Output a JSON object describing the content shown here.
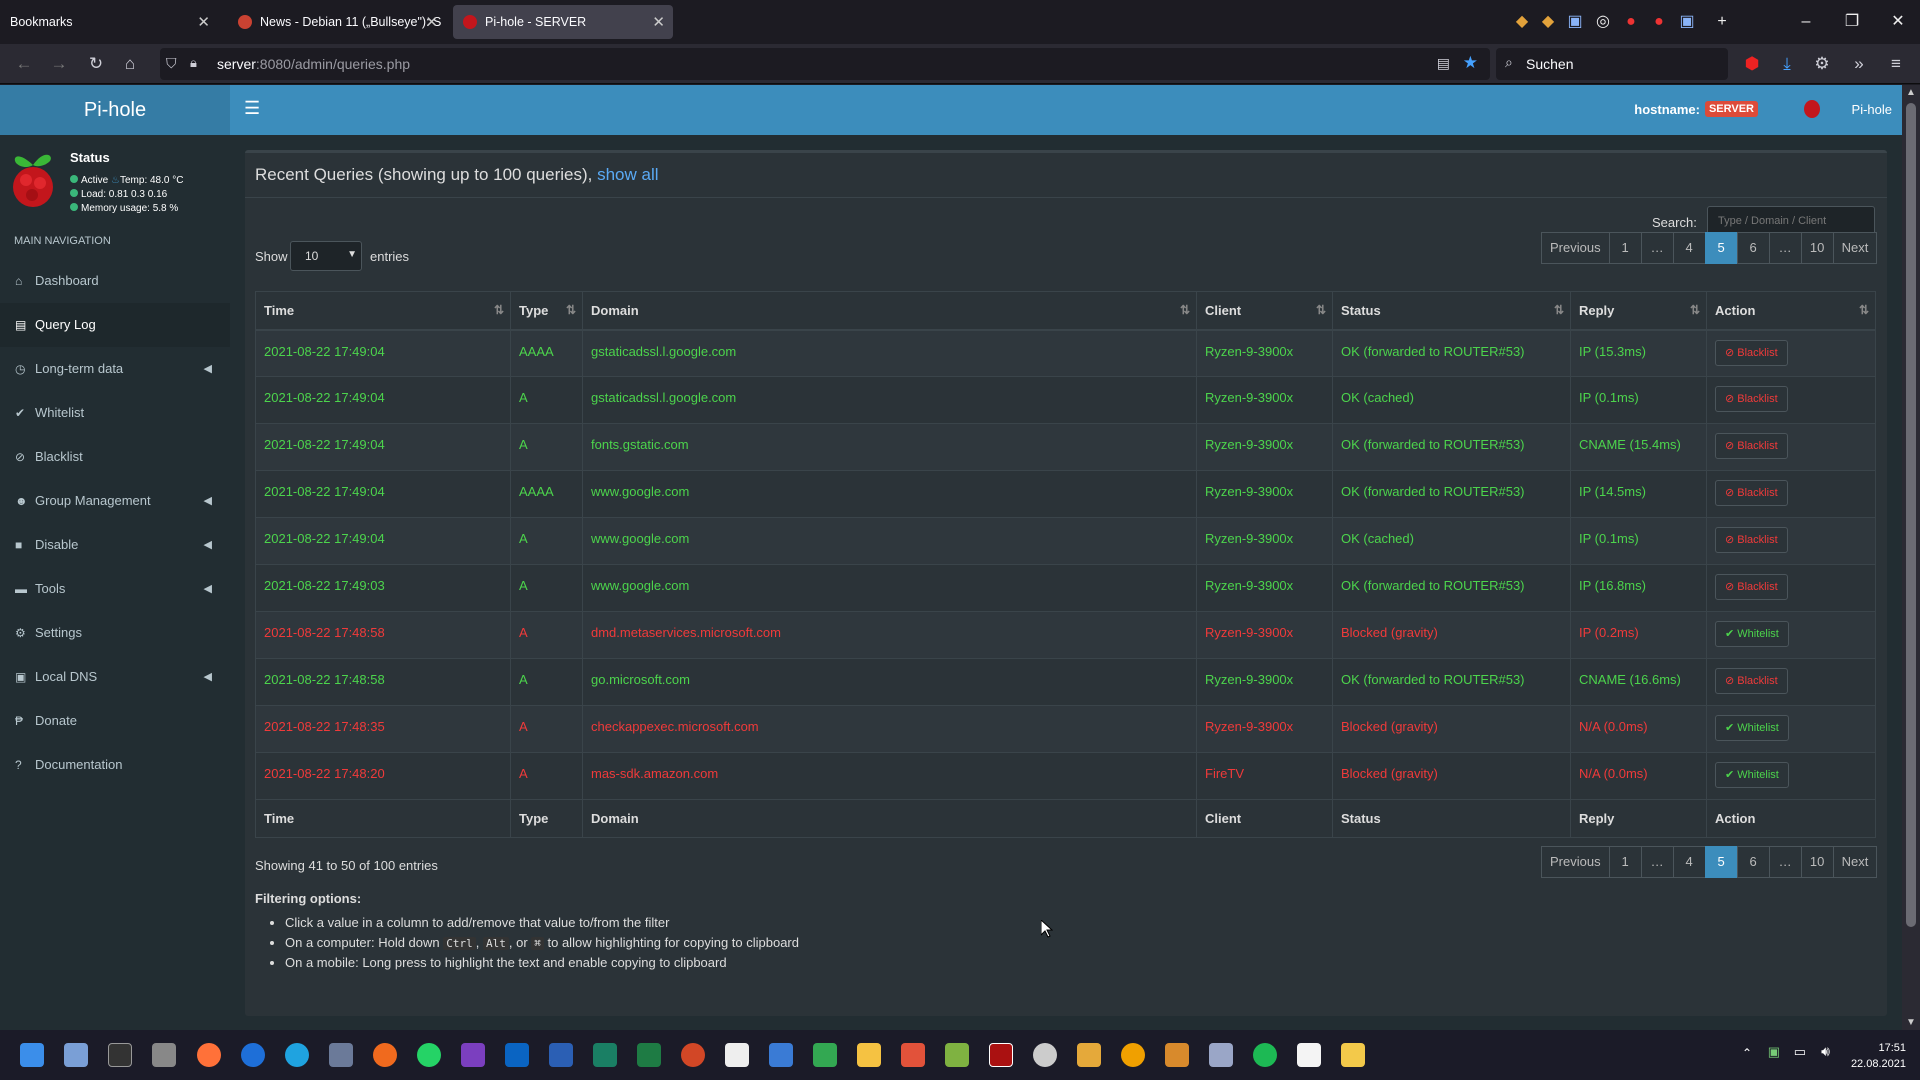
{
  "browser": {
    "tabs": [
      {
        "label": "Bookmarks"
      },
      {
        "label": "News - Debian 11 („Bullseye\"): S"
      },
      {
        "label": "Pi-hole - SERVER"
      }
    ],
    "url_host": "server",
    "url_path": ":8080/admin/queries.php",
    "search_placeholder": "Suchen"
  },
  "header": {
    "logo": "Pi-hole",
    "hostname_label": "hostname:",
    "hostname_value": "SERVER",
    "user_label": "Pi-hole"
  },
  "sidebar": {
    "status_title": "Status",
    "status_active": "Active",
    "status_temp": "Temp: 48.0 °C",
    "status_load": "Load:  0.81  0.3  0.16",
    "status_memory": "Memory usage:  5.8 %",
    "nav_header": "MAIN NAVIGATION",
    "items": [
      {
        "label": "Dashboard",
        "icon": "home-icon"
      },
      {
        "label": "Query Log",
        "icon": "file-icon"
      },
      {
        "label": "Long-term data",
        "icon": "clock-icon"
      },
      {
        "label": "Whitelist",
        "icon": "check-circle-icon"
      },
      {
        "label": "Blacklist",
        "icon": "ban-icon"
      },
      {
        "label": "Group Management",
        "icon": "users-icon"
      },
      {
        "label": "Disable",
        "icon": "stop-icon"
      },
      {
        "label": "Tools",
        "icon": "folder-icon"
      },
      {
        "label": "Settings",
        "icon": "cogs-icon"
      },
      {
        "label": "Local DNS",
        "icon": "address-book-icon"
      },
      {
        "label": "Donate",
        "icon": "paypal-icon"
      },
      {
        "label": "Documentation",
        "icon": "question-circle-icon"
      }
    ]
  },
  "main": {
    "title_prefix": "Recent Queries (showing up to 100 queries), ",
    "title_link": "show all",
    "show_label": "Show",
    "entries_value": "10",
    "entries_label": "entries",
    "search_label": "Search:",
    "search_placeholder": "Type / Domain / Client",
    "pagination": [
      "Previous",
      "1",
      "…",
      "4",
      "5",
      "6",
      "…",
      "10",
      "Next"
    ],
    "active_page": "5",
    "columns": [
      "Time",
      "Type",
      "Domain",
      "Client",
      "Status",
      "Reply",
      "Action"
    ],
    "rows": [
      {
        "time": "2021-08-22 17:49:04",
        "type": "AAAA",
        "domain": "gstaticadssl.l.google.com",
        "client": "Ryzen-9-3900x",
        "status": "OK (forwarded to ROUTER#53)",
        "reply": "IP (15.3ms)",
        "action": "Blacklist",
        "blocked": false
      },
      {
        "time": "2021-08-22 17:49:04",
        "type": "A",
        "domain": "gstaticadssl.l.google.com",
        "client": "Ryzen-9-3900x",
        "status": "OK (cached)",
        "reply": "IP (0.1ms)",
        "action": "Blacklist",
        "blocked": false
      },
      {
        "time": "2021-08-22 17:49:04",
        "type": "A",
        "domain": "fonts.gstatic.com",
        "client": "Ryzen-9-3900x",
        "status": "OK (forwarded to ROUTER#53)",
        "reply": "CNAME (15.4ms)",
        "action": "Blacklist",
        "blocked": false
      },
      {
        "time": "2021-08-22 17:49:04",
        "type": "AAAA",
        "domain": "www.google.com",
        "client": "Ryzen-9-3900x",
        "status": "OK (forwarded to ROUTER#53)",
        "reply": "IP (14.5ms)",
        "action": "Blacklist",
        "blocked": false
      },
      {
        "time": "2021-08-22 17:49:04",
        "type": "A",
        "domain": "www.google.com",
        "client": "Ryzen-9-3900x",
        "status": "OK (cached)",
        "reply": "IP (0.1ms)",
        "action": "Blacklist",
        "blocked": false
      },
      {
        "time": "2021-08-22 17:49:03",
        "type": "A",
        "domain": "www.google.com",
        "client": "Ryzen-9-3900x",
        "status": "OK (forwarded to ROUTER#53)",
        "reply": "IP (16.8ms)",
        "action": "Blacklist",
        "blocked": false
      },
      {
        "time": "2021-08-22 17:48:58",
        "type": "A",
        "domain": "dmd.metaservices.microsoft.com",
        "client": "Ryzen-9-3900x",
        "status": "Blocked (gravity)",
        "reply": "IP (0.2ms)",
        "action": "Whitelist",
        "blocked": true
      },
      {
        "time": "2021-08-22 17:48:58",
        "type": "A",
        "domain": "go.microsoft.com",
        "client": "Ryzen-9-3900x",
        "status": "OK (forwarded to ROUTER#53)",
        "reply": "CNAME (16.6ms)",
        "action": "Blacklist",
        "blocked": false
      },
      {
        "time": "2021-08-22 17:48:35",
        "type": "A",
        "domain": "checkappexec.microsoft.com",
        "client": "Ryzen-9-3900x",
        "status": "Blocked (gravity)",
        "reply": "N/A (0.0ms)",
        "action": "Whitelist",
        "blocked": true
      },
      {
        "time": "2021-08-22 17:48:20",
        "type": "A",
        "domain": "mas-sdk.amazon.com",
        "client": "FireTV",
        "status": "Blocked (gravity)",
        "reply": "N/A (0.0ms)",
        "action": "Whitelist",
        "blocked": true
      }
    ],
    "showing": "Showing 41 to 50 of 100 entries",
    "filter_title": "Filtering options:",
    "filter_1": "Click a value in a column to add/remove that value to/from the filter",
    "filter_2a": "On a computer: Hold down ",
    "filter_key1": "Ctrl",
    "filter_key2": "Alt",
    "filter_key3": "⌘",
    "filter_2b": " to allow highlighting for copying to clipboard",
    "filter_3": "On a mobile: Long press to highlight the text and enable copying to clipboard"
  },
  "taskbar": {
    "time": "17:51",
    "date": "22.08.2021"
  },
  "colors": {
    "accent": "#3c8dbc",
    "ok": "#4cd44c",
    "blocked": "#f03a3a",
    "hostname_badge": "#dd4b39"
  }
}
